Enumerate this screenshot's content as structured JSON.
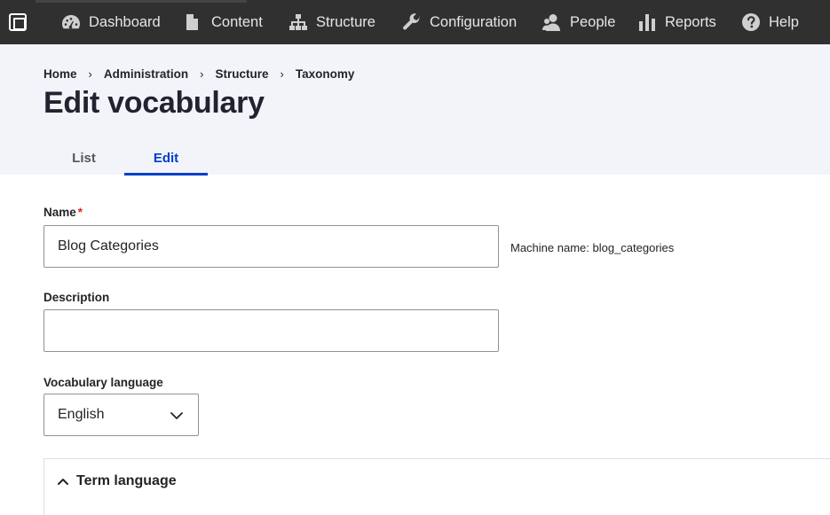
{
  "toolbar": {
    "items": [
      {
        "label": "Dashboard",
        "icon": "dashboard-icon"
      },
      {
        "label": "Content",
        "icon": "document-icon"
      },
      {
        "label": "Structure",
        "icon": "structure-icon"
      },
      {
        "label": "Configuration",
        "icon": "wrench-icon"
      },
      {
        "label": "People",
        "icon": "people-icon"
      },
      {
        "label": "Reports",
        "icon": "bar-chart-icon"
      },
      {
        "label": "Help",
        "icon": "help-icon"
      }
    ]
  },
  "breadcrumb": [
    "Home",
    "Administration",
    "Structure",
    "Taxonomy"
  ],
  "page_title": "Edit vocabulary",
  "tabs": [
    {
      "label": "List",
      "active": false
    },
    {
      "label": "Edit",
      "active": true
    }
  ],
  "form": {
    "name_label": "Name",
    "required_marker": "*",
    "name_value": "Blog Categories",
    "machine_name": "Machine name: blog_categories",
    "description_label": "Description",
    "description_value": "",
    "language_label": "Vocabulary language",
    "language_value": "English",
    "term_language_label": "Term language"
  },
  "colors": {
    "toolbar_bg": "#303030",
    "header_bg": "#f3f4f9",
    "accent": "#003ecc",
    "required": "#d72222"
  }
}
